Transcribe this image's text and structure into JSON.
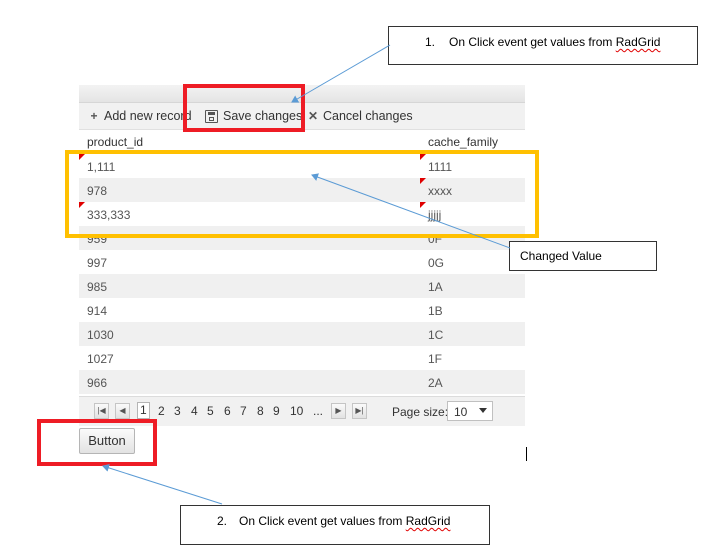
{
  "grid": {
    "commands": {
      "add": "Add new record",
      "add_icon": "plus-icon",
      "save": "Save changes",
      "save_icon": "disk-icon",
      "cancel": "Cancel changes",
      "cancel_icon": "x-icon"
    },
    "columns": [
      "product_id",
      "cache_family"
    ],
    "rows": [
      {
        "product_id": "1,111",
        "cache_family": "1111"
      },
      {
        "product_id": "978",
        "cache_family": "xxxx"
      },
      {
        "product_id": "333,333",
        "cache_family": "jjjjj"
      },
      {
        "product_id": "959",
        "cache_family": "0F"
      },
      {
        "product_id": "997",
        "cache_family": "0G"
      },
      {
        "product_id": "985",
        "cache_family": "1A"
      },
      {
        "product_id": "914",
        "cache_family": "1B"
      },
      {
        "product_id": "1030",
        "cache_family": "1C"
      },
      {
        "product_id": "1027",
        "cache_family": "1F"
      },
      {
        "product_id": "966",
        "cache_family": "2A"
      }
    ],
    "pager": {
      "pages": [
        "1",
        "2",
        "3",
        "4",
        "5",
        "6",
        "7",
        "8",
        "9",
        "10",
        "..."
      ],
      "current_page": "1",
      "page_size_label": "Page size:",
      "page_size": "10"
    }
  },
  "button": {
    "label": "Button"
  },
  "annotations": {
    "note1": {
      "num": "1.",
      "text_prefix": "On Click event get values from ",
      "text_link": "RadGrid"
    },
    "note2": {
      "num": "2.",
      "text_prefix": "On Click event get values from ",
      "text_link": "RadGrid"
    },
    "changed": "Changed Value"
  },
  "colors": {
    "red_box": "#ee1c25",
    "yellow_box": "#ffc000",
    "arrow": "#5b9bd5",
    "dirty_marker": "#e00000"
  }
}
